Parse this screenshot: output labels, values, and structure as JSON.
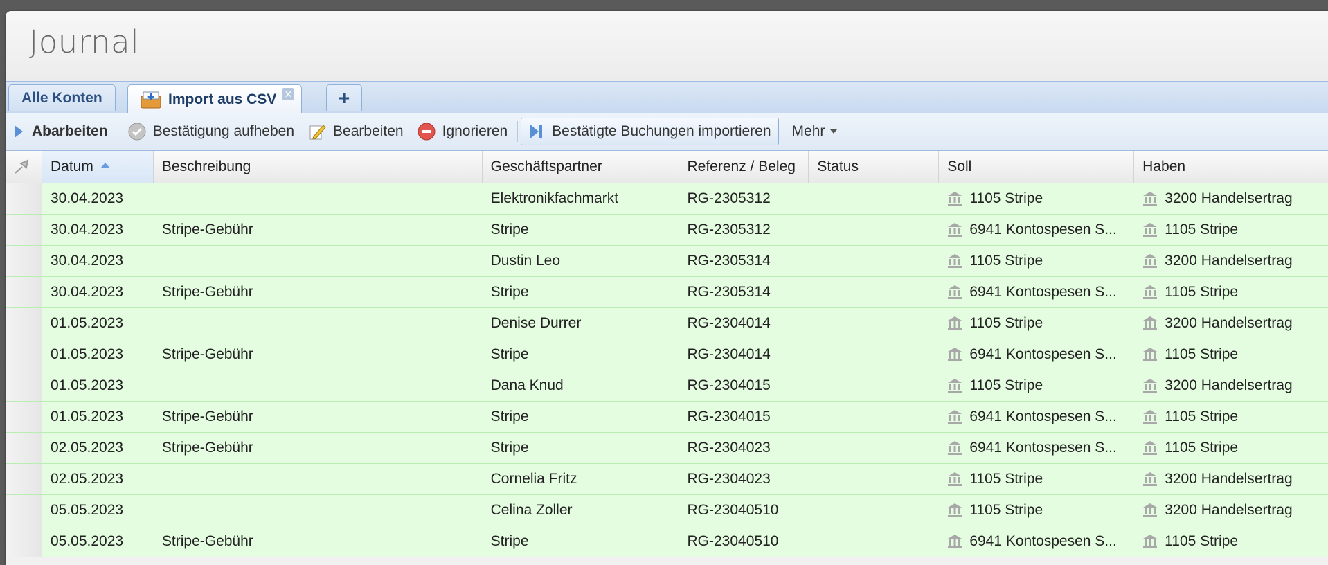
{
  "window": {
    "title": "Journal"
  },
  "tabs": [
    {
      "label": "Alle Konten",
      "icon": ""
    },
    {
      "label": "Import aus CSV",
      "icon": "csv-import-icon",
      "closable": true
    },
    {
      "label": "+",
      "icon": "plus-icon"
    }
  ],
  "toolbar": {
    "process": "Abarbeiten",
    "unconfirm": "Bestätigung aufheben",
    "edit": "Bearbeiten",
    "ignore": "Ignorieren",
    "import_confirmed": "Bestätigte Buchungen importieren",
    "more": "Mehr"
  },
  "grid": {
    "columns": [
      "Datum",
      "Beschreibung",
      "Geschäftspartner",
      "Referenz / Beleg",
      "Status",
      "Soll",
      "Haben"
    ],
    "sorted_column": "Datum",
    "sort_direction": "asc",
    "row_color": "#e4fde0",
    "rows": [
      {
        "date": "30.04.2023",
        "desc": "",
        "partner": "Elektronikfachmarkt",
        "ref": "RG-2305312",
        "status": "",
        "debit": "1105 Stripe",
        "credit": "3200 Handelsertrag"
      },
      {
        "date": "30.04.2023",
        "desc": "Stripe-Gebühr",
        "partner": "Stripe",
        "ref": "RG-2305312",
        "status": "",
        "debit": "6941 Kontospesen S...",
        "credit": "1105 Stripe"
      },
      {
        "date": "30.04.2023",
        "desc": "",
        "partner": "Dustin Leo",
        "ref": "RG-2305314",
        "status": "",
        "debit": "1105 Stripe",
        "credit": "3200 Handelsertrag"
      },
      {
        "date": "30.04.2023",
        "desc": "Stripe-Gebühr",
        "partner": "Stripe",
        "ref": "RG-2305314",
        "status": "",
        "debit": "6941 Kontospesen S...",
        "credit": "1105 Stripe"
      },
      {
        "date": "01.05.2023",
        "desc": "",
        "partner": "Denise Durrer",
        "ref": "RG-2304014",
        "status": "",
        "debit": "1105 Stripe",
        "credit": "3200 Handelsertrag"
      },
      {
        "date": "01.05.2023",
        "desc": "Stripe-Gebühr",
        "partner": "Stripe",
        "ref": "RG-2304014",
        "status": "",
        "debit": "6941 Kontospesen S...",
        "credit": "1105 Stripe"
      },
      {
        "date": "01.05.2023",
        "desc": "",
        "partner": "Dana Knud",
        "ref": "RG-2304015",
        "status": "",
        "debit": "1105 Stripe",
        "credit": "3200 Handelsertrag"
      },
      {
        "date": "01.05.2023",
        "desc": "Stripe-Gebühr",
        "partner": "Stripe",
        "ref": "RG-2304015",
        "status": "",
        "debit": "6941 Kontospesen S...",
        "credit": "1105 Stripe"
      },
      {
        "date": "02.05.2023",
        "desc": "Stripe-Gebühr",
        "partner": "Stripe",
        "ref": "RG-2304023",
        "status": "",
        "debit": "6941 Kontospesen S...",
        "credit": "1105 Stripe"
      },
      {
        "date": "02.05.2023",
        "desc": "",
        "partner": "Cornelia Fritz",
        "ref": "RG-2304023",
        "status": "",
        "debit": "1105 Stripe",
        "credit": "3200 Handelsertrag"
      },
      {
        "date": "05.05.2023",
        "desc": "",
        "partner": "Celina Zoller",
        "ref": "RG-23040510",
        "status": "",
        "debit": "1105 Stripe",
        "credit": "3200 Handelsertrag"
      },
      {
        "date": "05.05.2023",
        "desc": "Stripe-Gebühr",
        "partner": "Stripe",
        "ref": "RG-23040510",
        "status": "",
        "debit": "6941 Kontospesen S...",
        "credit": "1105 Stripe"
      }
    ]
  }
}
